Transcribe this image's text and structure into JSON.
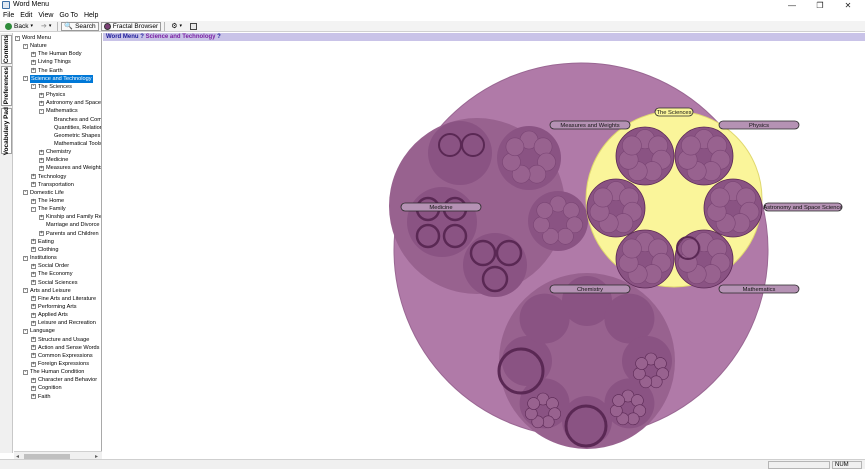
{
  "window": {
    "title": "Word Menu",
    "minimize": "—",
    "maximize": "❐",
    "close": "✕"
  },
  "menu": [
    "File",
    "Edit",
    "View",
    "Go To",
    "Help"
  ],
  "toolbar": {
    "back": "Back",
    "search": "Search",
    "fractal": "Fractal Browser"
  },
  "tabs": [
    "Contents",
    "Preferences",
    "Vocabulary Pad"
  ],
  "tree": [
    {
      "label": "Word Menu",
      "d": 0,
      "exp": "-"
    },
    {
      "label": "Nature",
      "d": 1,
      "exp": "-"
    },
    {
      "label": "The Human Body",
      "d": 2,
      "exp": "+"
    },
    {
      "label": "Living Things",
      "d": 2,
      "exp": "+"
    },
    {
      "label": "The Earth",
      "d": 2,
      "exp": "+"
    },
    {
      "label": "Science and Technology",
      "d": 1,
      "exp": "-",
      "selected": true
    },
    {
      "label": "The Sciences",
      "d": 2,
      "exp": "-"
    },
    {
      "label": "Physics",
      "d": 3,
      "exp": "+"
    },
    {
      "label": "Astronomy and Space S",
      "d": 3,
      "exp": "+"
    },
    {
      "label": "Mathematics",
      "d": 3,
      "exp": "-"
    },
    {
      "label": "Branches and Comp",
      "d": 4,
      "exp": ""
    },
    {
      "label": "Quantities, Relation",
      "d": 4,
      "exp": ""
    },
    {
      "label": "Geometric Shapes a",
      "d": 4,
      "exp": ""
    },
    {
      "label": "Mathematical Tools",
      "d": 4,
      "exp": ""
    },
    {
      "label": "Chemistry",
      "d": 3,
      "exp": "+"
    },
    {
      "label": "Medicine",
      "d": 3,
      "exp": "+"
    },
    {
      "label": "Measures and Weights",
      "d": 3,
      "exp": "+"
    },
    {
      "label": "Technology",
      "d": 2,
      "exp": "+"
    },
    {
      "label": "Transportation",
      "d": 2,
      "exp": "+"
    },
    {
      "label": "Domestic Life",
      "d": 1,
      "exp": "-"
    },
    {
      "label": "The Home",
      "d": 2,
      "exp": "+"
    },
    {
      "label": "The Family",
      "d": 2,
      "exp": "-"
    },
    {
      "label": "Kinship and Family Rel",
      "d": 3,
      "exp": "+"
    },
    {
      "label": "Marriage and Divorce",
      "d": 3,
      "exp": ""
    },
    {
      "label": "Parents and Children",
      "d": 3,
      "exp": "+"
    },
    {
      "label": "Eating",
      "d": 2,
      "exp": "+"
    },
    {
      "label": "Clothing",
      "d": 2,
      "exp": "+"
    },
    {
      "label": "Institutions",
      "d": 1,
      "exp": "-"
    },
    {
      "label": "Social Order",
      "d": 2,
      "exp": "+"
    },
    {
      "label": "The Economy",
      "d": 2,
      "exp": "+"
    },
    {
      "label": "Social Sciences",
      "d": 2,
      "exp": "+"
    },
    {
      "label": "Arts and Leisure",
      "d": 1,
      "exp": "-"
    },
    {
      "label": "Fine Arts and Literature",
      "d": 2,
      "exp": "+"
    },
    {
      "label": "Performing Arts",
      "d": 2,
      "exp": "+"
    },
    {
      "label": "Applied Arts",
      "d": 2,
      "exp": "+"
    },
    {
      "label": "Leisure and Recreation",
      "d": 2,
      "exp": "+"
    },
    {
      "label": "Language",
      "d": 1,
      "exp": "-"
    },
    {
      "label": "Structure and Usage",
      "d": 2,
      "exp": "+"
    },
    {
      "label": "Action and Sense Words",
      "d": 2,
      "exp": "+"
    },
    {
      "label": "Common Expressions",
      "d": 2,
      "exp": "+"
    },
    {
      "label": "Foreign Expressions",
      "d": 2,
      "exp": "+"
    },
    {
      "label": "The Human Condition",
      "d": 1,
      "exp": "-"
    },
    {
      "label": "Character and Behavior",
      "d": 2,
      "exp": "+"
    },
    {
      "label": "Cognition",
      "d": 2,
      "exp": "+"
    },
    {
      "label": "Faith",
      "d": 2,
      "exp": "+"
    }
  ],
  "breadcrumb": {
    "root": "Word Menu",
    "current": "Science and Technology",
    "q1": "?",
    "q2": "?"
  },
  "fractal": {
    "labels": {
      "sciences": "The Sciences",
      "measures": "Measures and Weights",
      "physics": "Physics",
      "medicine": "Medicine",
      "astronomy": "Astronomy and Space Science",
      "chemistry": "Chemistry",
      "mathematics": "Mathematics"
    },
    "colors": {
      "outer": "#b07aa8",
      "inner": "#98628f",
      "circle": "#8a5383",
      "dark": "#5a2854",
      "highlight": "#faf59a",
      "tag": "#b592b4"
    }
  },
  "status": {
    "num": "NUM"
  }
}
